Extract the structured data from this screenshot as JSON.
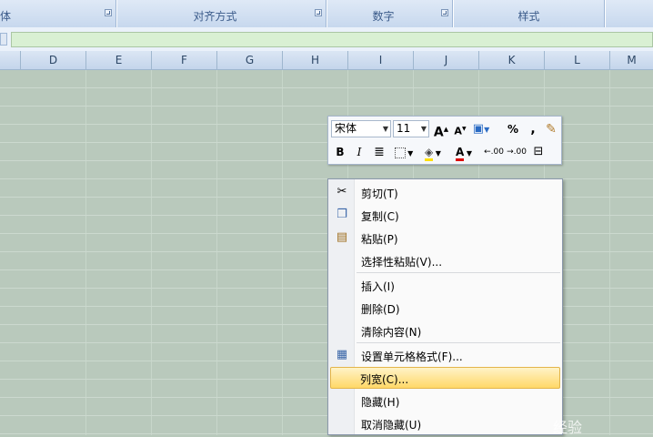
{
  "ribbon": {
    "groups": [
      {
        "label": "体"
      },
      {
        "label": "对齐方式"
      },
      {
        "label": "数字"
      },
      {
        "label": "样式"
      }
    ]
  },
  "columns": [
    "D",
    "E",
    "F",
    "G",
    "H",
    "I",
    "J",
    "K",
    "L",
    "M"
  ],
  "mini_toolbar": {
    "font_name": "宋体",
    "font_size": "11",
    "grow_font": "A",
    "shrink_font": "A",
    "percent": "%",
    "comma": ",",
    "bold": "B",
    "italic": "I",
    "font_color": "A",
    "inc_decimal": ".00",
    "dec_decimal": ".00"
  },
  "context_menu": {
    "items": [
      {
        "label": "剪切(T)",
        "icon": "scissors-icon"
      },
      {
        "label": "复制(C)",
        "icon": "copy-icon"
      },
      {
        "label": "粘贴(P)",
        "icon": "paste-icon"
      },
      {
        "label": "选择性粘贴(V)..."
      },
      {
        "label": "插入(I)"
      },
      {
        "label": "删除(D)"
      },
      {
        "label": "清除内容(N)"
      },
      {
        "label": "设置单元格格式(F)...",
        "icon": "format-cells-icon"
      },
      {
        "label": "列宽(C)...",
        "highlighted": true
      },
      {
        "label": "隐藏(H)"
      },
      {
        "label": "取消隐藏(U)"
      }
    ]
  },
  "watermark": "经验",
  "colors": {
    "highlight": "#ffd868",
    "grid_bg": "#b9c9bc",
    "header": "#c4d5eb"
  }
}
